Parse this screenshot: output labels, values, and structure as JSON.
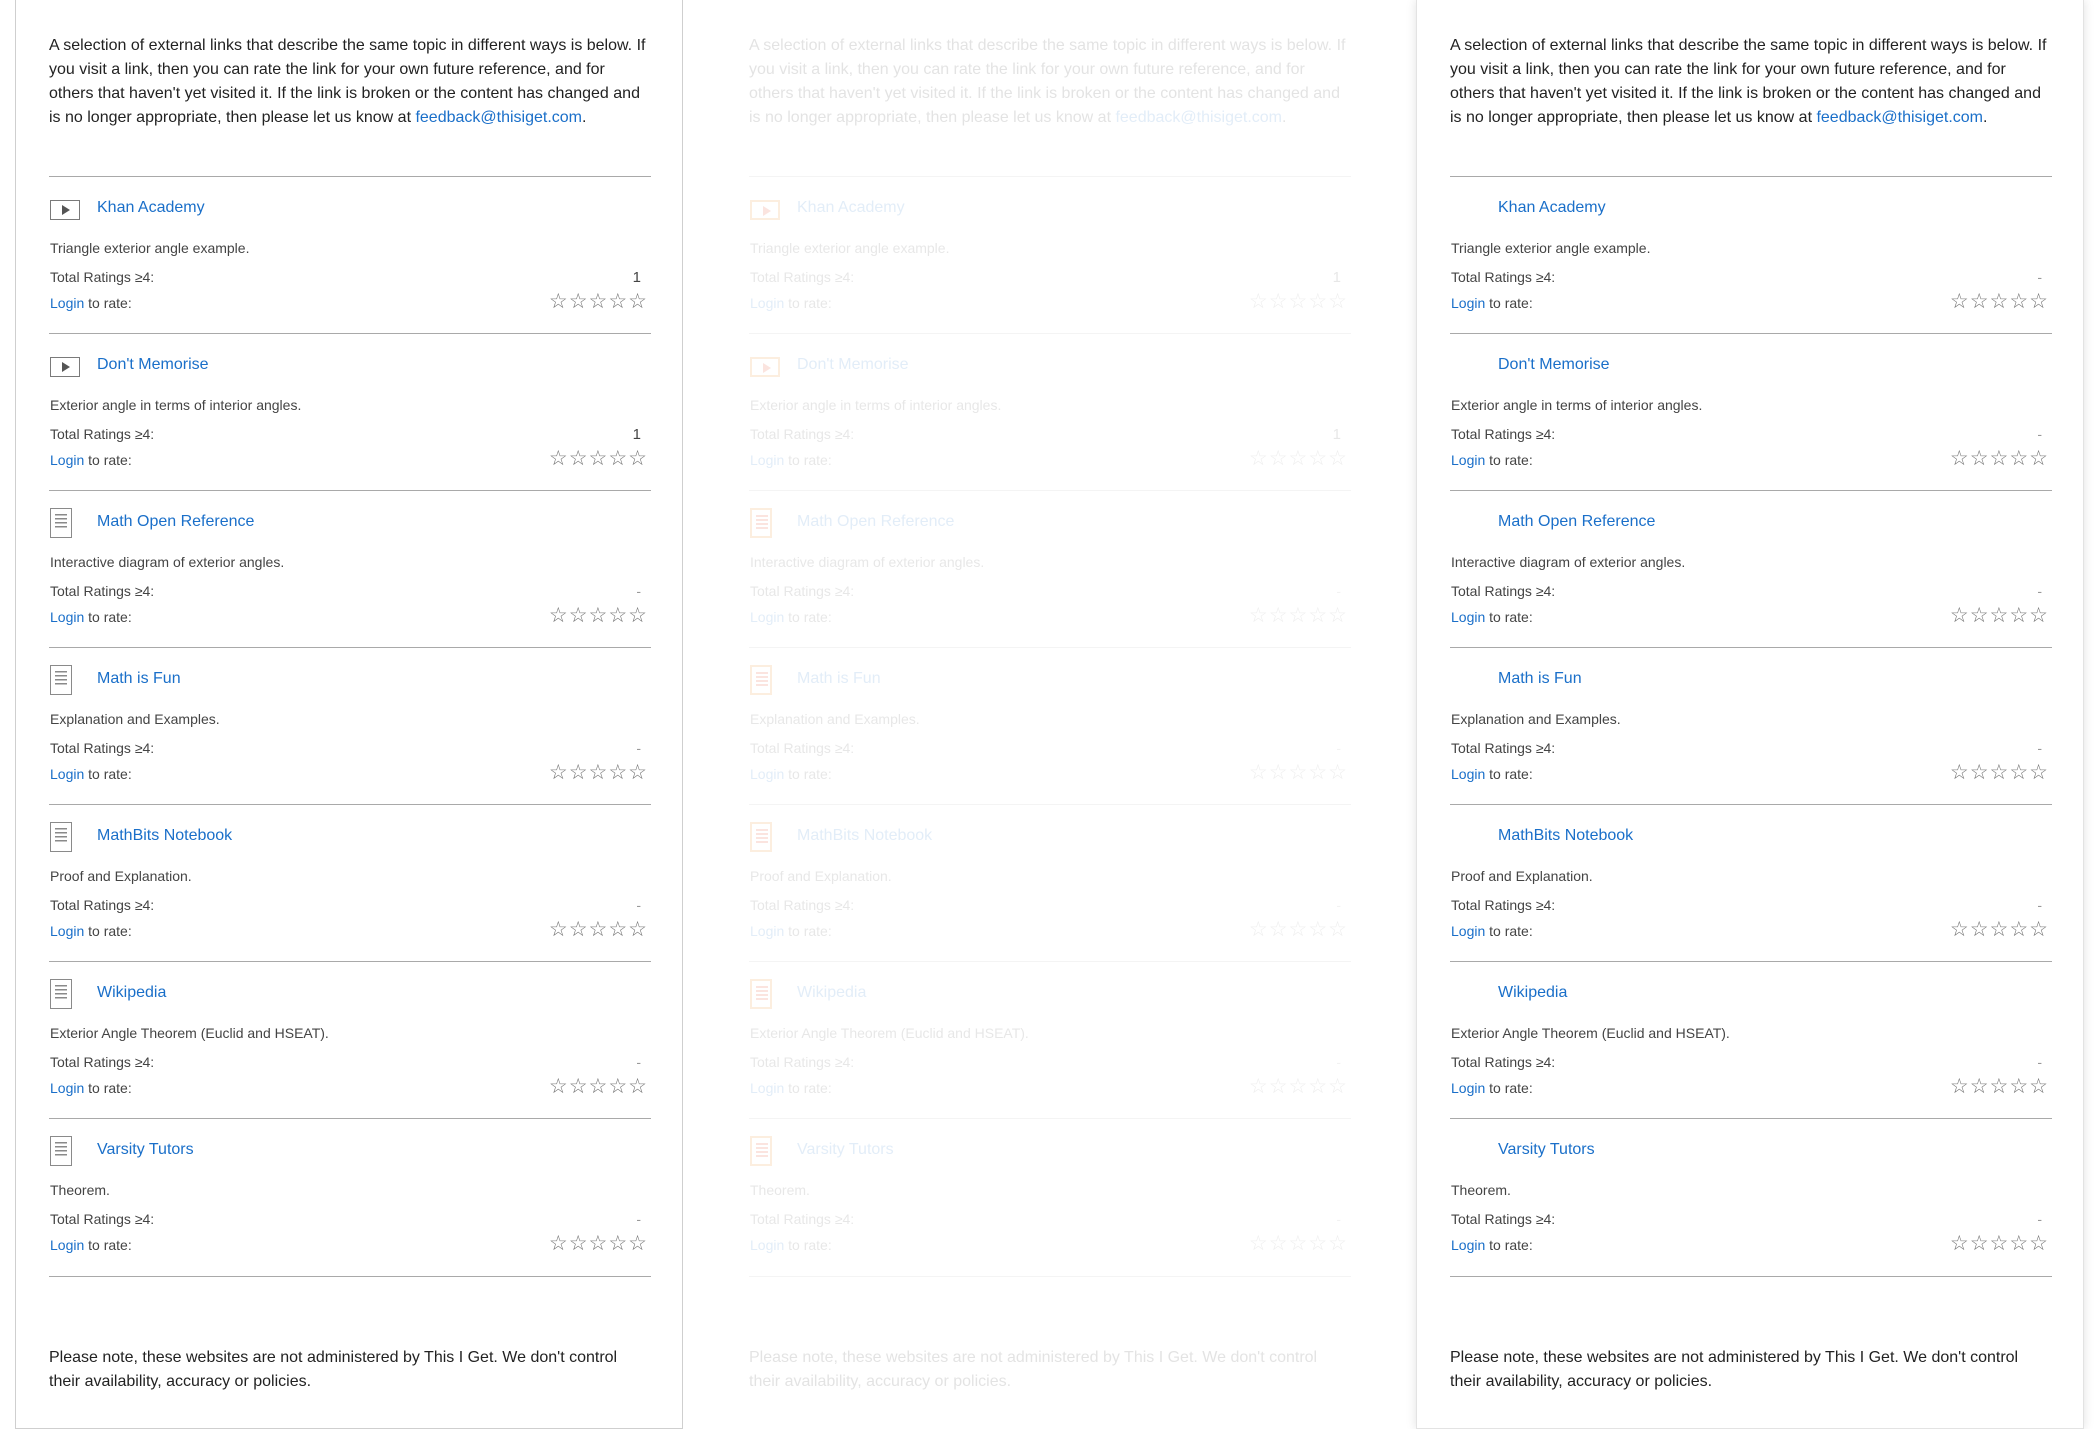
{
  "intro": {
    "text": "A selection of external links that describe the same topic in different ways is below. If you visit a link, then you can rate the link for your own future reference, and for others that haven't yet visited it. If the link is broken or the content has changed and is no longer appropriate, then please let us know at ",
    "email": "feedback@thisiget.com",
    "end": "."
  },
  "labels": {
    "total_ratings": "Total Ratings ≥4:",
    "login": "Login",
    "to_rate": " to rate:",
    "star": "☆"
  },
  "note": "Please note, these websites are not administered by This I Get. We don't control their availability, accuracy or policies.",
  "panels": [
    {
      "links": [
        {
          "icon": "video-icon",
          "title": "Khan Academy",
          "desc": "Triangle exterior angle example.",
          "total": "1"
        },
        {
          "icon": "video-icon",
          "title": "Don't Memorise",
          "desc": "Exterior angle in terms of interior angles.",
          "total": "1"
        },
        {
          "icon": "document-icon",
          "title": "Math Open Reference",
          "desc": "Interactive diagram of exterior angles.",
          "total": "-"
        },
        {
          "icon": "document-icon",
          "title": "Math is Fun",
          "desc": "Explanation and Examples.",
          "total": "-"
        },
        {
          "icon": "document-icon",
          "title": "MathBits Notebook",
          "desc": "Proof and Explanation.",
          "total": "-"
        },
        {
          "icon": "document-icon",
          "title": "Wikipedia",
          "desc": "Exterior Angle Theorem (Euclid and HSEAT).",
          "total": "-"
        },
        {
          "icon": "document-icon",
          "title": "Varsity Tutors",
          "desc": "Theorem.",
          "total": "-"
        }
      ]
    },
    {
      "links": [
        {
          "icon": "video-icon",
          "title": "Khan Academy",
          "desc": "Triangle exterior angle example.",
          "total": "1"
        },
        {
          "icon": "video-icon",
          "title": "Don't Memorise",
          "desc": "Exterior angle in terms of interior angles.",
          "total": "1"
        },
        {
          "icon": "document-icon",
          "title": "Math Open Reference",
          "desc": "Interactive diagram of exterior angles.",
          "total": "-"
        },
        {
          "icon": "document-icon",
          "title": "Math is Fun",
          "desc": "Explanation and Examples.",
          "total": "-"
        },
        {
          "icon": "document-icon",
          "title": "MathBits Notebook",
          "desc": "Proof and Explanation.",
          "total": "-"
        },
        {
          "icon": "document-icon",
          "title": "Wikipedia",
          "desc": "Exterior Angle Theorem (Euclid and HSEAT).",
          "total": "-"
        },
        {
          "icon": "document-icon",
          "title": "Varsity Tutors",
          "desc": "Theorem.",
          "total": "-"
        }
      ]
    },
    {
      "links": [
        {
          "icon": "",
          "title": "Khan Academy",
          "desc": "Triangle exterior angle example.",
          "total": "-"
        },
        {
          "icon": "",
          "title": "Don't Memorise",
          "desc": "Exterior angle in terms of interior angles.",
          "total": "-"
        },
        {
          "icon": "",
          "title": "Math Open Reference",
          "desc": "Interactive diagram of exterior angles.",
          "total": "-"
        },
        {
          "icon": "",
          "title": "Math is Fun",
          "desc": "Explanation and Examples.",
          "total": "-"
        },
        {
          "icon": "",
          "title": "MathBits Notebook",
          "desc": "Proof and Explanation.",
          "total": "-"
        },
        {
          "icon": "",
          "title": "Wikipedia",
          "desc": "Exterior Angle Theorem (Euclid and HSEAT).",
          "total": "-"
        },
        {
          "icon": "",
          "title": "Varsity Tutors",
          "desc": "Theorem.",
          "total": "-"
        }
      ]
    }
  ]
}
